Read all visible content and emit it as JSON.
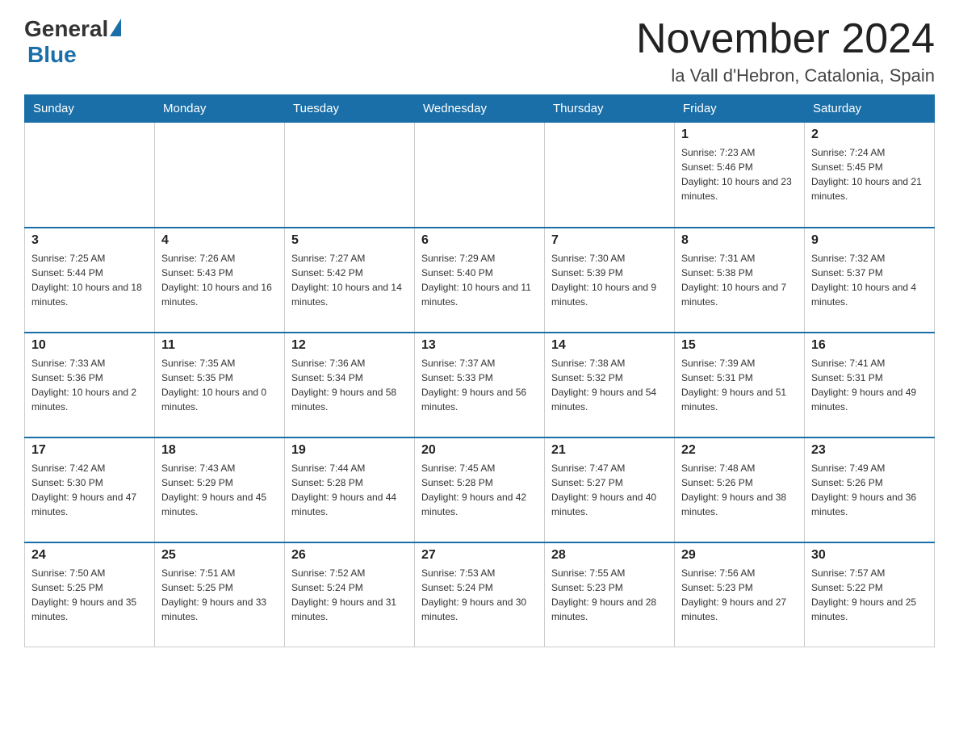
{
  "header": {
    "logo_general": "General",
    "logo_blue": "Blue",
    "month_title": "November 2024",
    "subtitle": "la Vall d'Hebron, Catalonia, Spain"
  },
  "days_of_week": [
    "Sunday",
    "Monday",
    "Tuesday",
    "Wednesday",
    "Thursday",
    "Friday",
    "Saturday"
  ],
  "weeks": [
    [
      {
        "day": "",
        "info": ""
      },
      {
        "day": "",
        "info": ""
      },
      {
        "day": "",
        "info": ""
      },
      {
        "day": "",
        "info": ""
      },
      {
        "day": "",
        "info": ""
      },
      {
        "day": "1",
        "info": "Sunrise: 7:23 AM\nSunset: 5:46 PM\nDaylight: 10 hours and 23 minutes."
      },
      {
        "day": "2",
        "info": "Sunrise: 7:24 AM\nSunset: 5:45 PM\nDaylight: 10 hours and 21 minutes."
      }
    ],
    [
      {
        "day": "3",
        "info": "Sunrise: 7:25 AM\nSunset: 5:44 PM\nDaylight: 10 hours and 18 minutes."
      },
      {
        "day": "4",
        "info": "Sunrise: 7:26 AM\nSunset: 5:43 PM\nDaylight: 10 hours and 16 minutes."
      },
      {
        "day": "5",
        "info": "Sunrise: 7:27 AM\nSunset: 5:42 PM\nDaylight: 10 hours and 14 minutes."
      },
      {
        "day": "6",
        "info": "Sunrise: 7:29 AM\nSunset: 5:40 PM\nDaylight: 10 hours and 11 minutes."
      },
      {
        "day": "7",
        "info": "Sunrise: 7:30 AM\nSunset: 5:39 PM\nDaylight: 10 hours and 9 minutes."
      },
      {
        "day": "8",
        "info": "Sunrise: 7:31 AM\nSunset: 5:38 PM\nDaylight: 10 hours and 7 minutes."
      },
      {
        "day": "9",
        "info": "Sunrise: 7:32 AM\nSunset: 5:37 PM\nDaylight: 10 hours and 4 minutes."
      }
    ],
    [
      {
        "day": "10",
        "info": "Sunrise: 7:33 AM\nSunset: 5:36 PM\nDaylight: 10 hours and 2 minutes."
      },
      {
        "day": "11",
        "info": "Sunrise: 7:35 AM\nSunset: 5:35 PM\nDaylight: 10 hours and 0 minutes."
      },
      {
        "day": "12",
        "info": "Sunrise: 7:36 AM\nSunset: 5:34 PM\nDaylight: 9 hours and 58 minutes."
      },
      {
        "day": "13",
        "info": "Sunrise: 7:37 AM\nSunset: 5:33 PM\nDaylight: 9 hours and 56 minutes."
      },
      {
        "day": "14",
        "info": "Sunrise: 7:38 AM\nSunset: 5:32 PM\nDaylight: 9 hours and 54 minutes."
      },
      {
        "day": "15",
        "info": "Sunrise: 7:39 AM\nSunset: 5:31 PM\nDaylight: 9 hours and 51 minutes."
      },
      {
        "day": "16",
        "info": "Sunrise: 7:41 AM\nSunset: 5:31 PM\nDaylight: 9 hours and 49 minutes."
      }
    ],
    [
      {
        "day": "17",
        "info": "Sunrise: 7:42 AM\nSunset: 5:30 PM\nDaylight: 9 hours and 47 minutes."
      },
      {
        "day": "18",
        "info": "Sunrise: 7:43 AM\nSunset: 5:29 PM\nDaylight: 9 hours and 45 minutes."
      },
      {
        "day": "19",
        "info": "Sunrise: 7:44 AM\nSunset: 5:28 PM\nDaylight: 9 hours and 44 minutes."
      },
      {
        "day": "20",
        "info": "Sunrise: 7:45 AM\nSunset: 5:28 PM\nDaylight: 9 hours and 42 minutes."
      },
      {
        "day": "21",
        "info": "Sunrise: 7:47 AM\nSunset: 5:27 PM\nDaylight: 9 hours and 40 minutes."
      },
      {
        "day": "22",
        "info": "Sunrise: 7:48 AM\nSunset: 5:26 PM\nDaylight: 9 hours and 38 minutes."
      },
      {
        "day": "23",
        "info": "Sunrise: 7:49 AM\nSunset: 5:26 PM\nDaylight: 9 hours and 36 minutes."
      }
    ],
    [
      {
        "day": "24",
        "info": "Sunrise: 7:50 AM\nSunset: 5:25 PM\nDaylight: 9 hours and 35 minutes."
      },
      {
        "day": "25",
        "info": "Sunrise: 7:51 AM\nSunset: 5:25 PM\nDaylight: 9 hours and 33 minutes."
      },
      {
        "day": "26",
        "info": "Sunrise: 7:52 AM\nSunset: 5:24 PM\nDaylight: 9 hours and 31 minutes."
      },
      {
        "day": "27",
        "info": "Sunrise: 7:53 AM\nSunset: 5:24 PM\nDaylight: 9 hours and 30 minutes."
      },
      {
        "day": "28",
        "info": "Sunrise: 7:55 AM\nSunset: 5:23 PM\nDaylight: 9 hours and 28 minutes."
      },
      {
        "day": "29",
        "info": "Sunrise: 7:56 AM\nSunset: 5:23 PM\nDaylight: 9 hours and 27 minutes."
      },
      {
        "day": "30",
        "info": "Sunrise: 7:57 AM\nSunset: 5:22 PM\nDaylight: 9 hours and 25 minutes."
      }
    ]
  ]
}
